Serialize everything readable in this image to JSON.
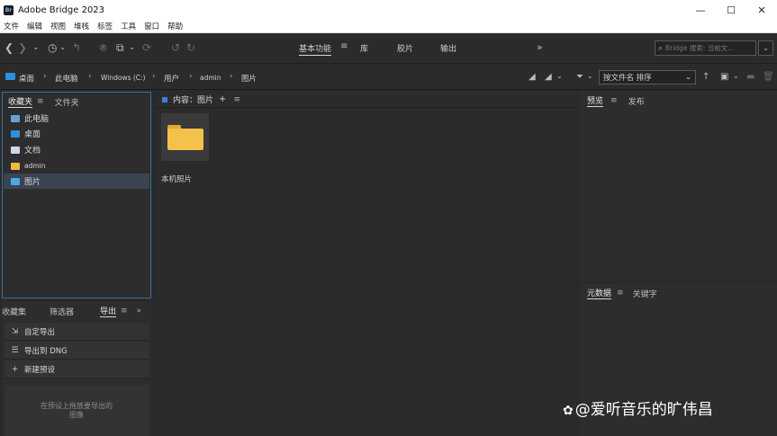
{
  "window": {
    "app_icon": "Br",
    "title": "Adobe Bridge 2023",
    "controls": [
      "—",
      "☐",
      "✕"
    ]
  },
  "menu": [
    "文件",
    "编辑",
    "视图",
    "堆栈",
    "标签",
    "工具",
    "窗口",
    "帮助"
  ],
  "toolbar": {
    "workspaces": [
      "基本功能",
      "库",
      "胶片",
      "输出"
    ],
    "active_workspace": "基本功能",
    "workspace_menu": "≡",
    "more": "»",
    "search_placeholder": "Bridge 搜索: 当前文..."
  },
  "pathbar": {
    "crumbs": [
      "桌面",
      "此电脑",
      "Windows (C:)",
      "用户",
      "admin",
      "图片"
    ],
    "sort_label": "按文件名 排序",
    "sort_arrow": "⌄"
  },
  "favorites": {
    "tabs": [
      "收藏夹",
      "文件夹"
    ],
    "menu": "≡",
    "items": [
      {
        "label": "此电脑",
        "icon": "computer-icon",
        "color": "#6aa0d8"
      },
      {
        "label": "桌面",
        "icon": "desktop-icon",
        "color": "#2f8fdc"
      },
      {
        "label": "文档",
        "icon": "documents-icon",
        "color": "#c9d8e8"
      },
      {
        "label": "admin",
        "icon": "folder-icon",
        "color": "#f0b840"
      },
      {
        "label": "图片",
        "icon": "pictures-icon",
        "color": "#4aa8e8"
      }
    ],
    "selected_index": 4
  },
  "export_panel": {
    "tabs": [
      "收藏集",
      "筛选器",
      "导出"
    ],
    "active_tab": "导出",
    "menu": "≡",
    "more": "»",
    "items": [
      {
        "label": "自定导出",
        "icon": "export-icon",
        "glyph": "⇲"
      },
      {
        "label": "导出到 DNG",
        "icon": "list-icon",
        "glyph": "☰"
      },
      {
        "label": "新建预设",
        "icon": "plus-icon",
        "glyph": "+"
      }
    ],
    "drop_hint_line1": "在预设上拖放要导出的",
    "drop_hint_line2": "图像"
  },
  "content": {
    "header": "内容：图片",
    "add": "+",
    "menu": "≡",
    "items": [
      {
        "label": "本机照片",
        "type": "folder"
      }
    ]
  },
  "preview_panel": {
    "tabs": [
      "预览",
      "发布"
    ],
    "active_tab": "预览",
    "menu": "≡"
  },
  "metadata_panel": {
    "tabs": [
      "元数据",
      "关键字"
    ],
    "active_tab": "元数据",
    "menu": "≡"
  },
  "watermark": {
    "icon": "weibo-icon",
    "glyph": "✿",
    "text": "@爱听音乐的旷伟昌"
  },
  "colors": {
    "accent": "#3f7fd8",
    "folder": "#f4c14a",
    "selection": "#3b4452"
  }
}
